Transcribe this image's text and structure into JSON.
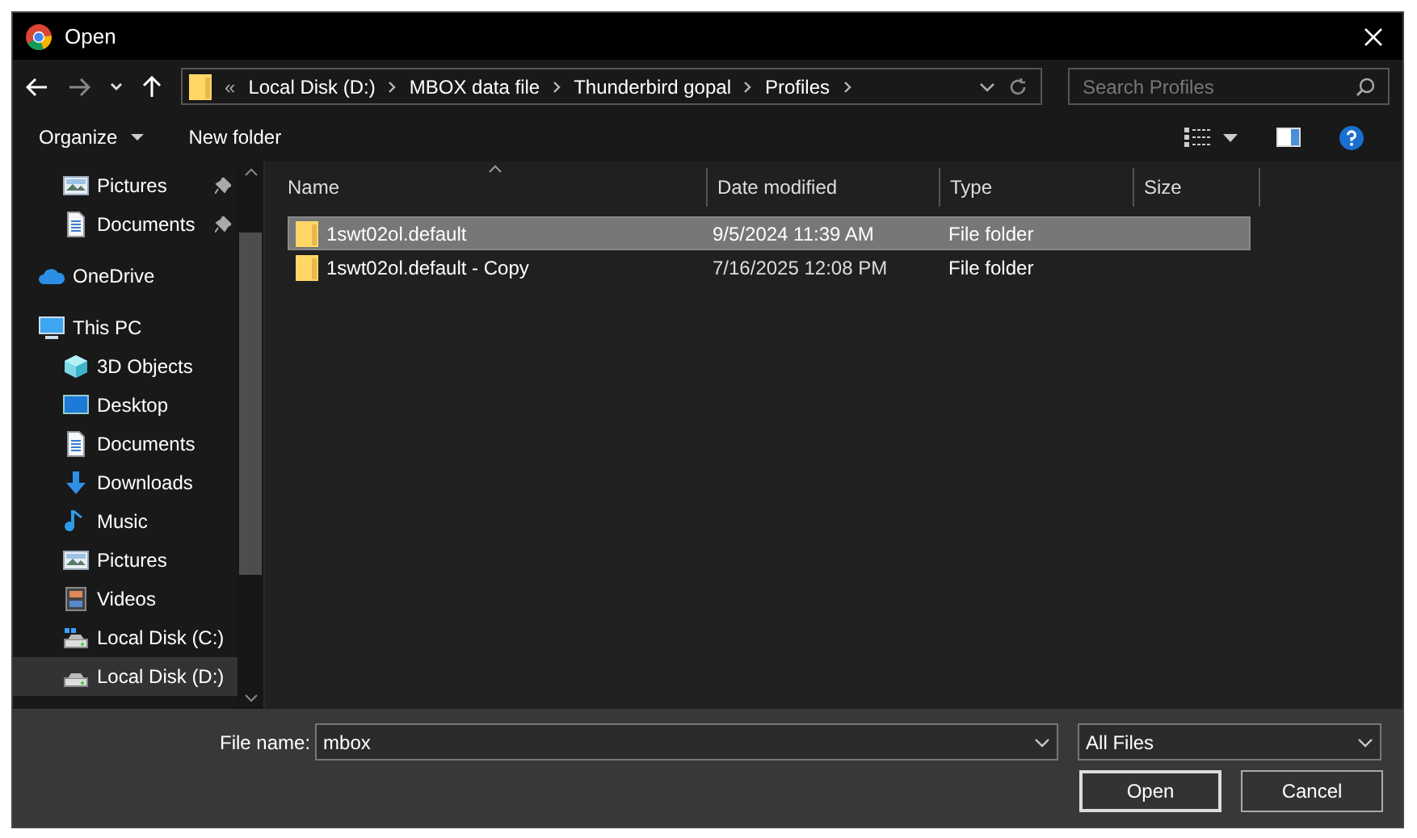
{
  "window": {
    "title": "Open"
  },
  "address": {
    "crumbs": [
      "Local Disk (D:)",
      "MBOX data file",
      "Thunderbird gopal",
      "Profiles"
    ],
    "overflow": "«"
  },
  "search": {
    "placeholder": "Search Profiles"
  },
  "toolbar": {
    "organize": "Organize",
    "new_folder": "New folder"
  },
  "sidebar": {
    "items": [
      {
        "label": "Pictures",
        "kind": "pictures",
        "pinned": true,
        "indent": true,
        "selected": false
      },
      {
        "label": "Documents",
        "kind": "documents",
        "pinned": true,
        "indent": true,
        "selected": false
      },
      {
        "label": "OneDrive",
        "kind": "cloud",
        "pinned": false,
        "indent": false,
        "selected": false
      },
      {
        "label": "This PC",
        "kind": "pc",
        "pinned": false,
        "indent": false,
        "selected": false
      },
      {
        "label": "3D Objects",
        "kind": "cube",
        "pinned": false,
        "indent": true,
        "selected": false
      },
      {
        "label": "Desktop",
        "kind": "desktop",
        "pinned": false,
        "indent": true,
        "selected": false
      },
      {
        "label": "Documents",
        "kind": "documents",
        "pinned": false,
        "indent": true,
        "selected": false
      },
      {
        "label": "Downloads",
        "kind": "download",
        "pinned": false,
        "indent": true,
        "selected": false
      },
      {
        "label": "Music",
        "kind": "music",
        "pinned": false,
        "indent": true,
        "selected": false
      },
      {
        "label": "Pictures",
        "kind": "pictures",
        "pinned": false,
        "indent": true,
        "selected": false
      },
      {
        "label": "Videos",
        "kind": "videos",
        "pinned": false,
        "indent": true,
        "selected": false
      },
      {
        "label": "Local Disk (C:)",
        "kind": "disk_c",
        "pinned": false,
        "indent": true,
        "selected": false
      },
      {
        "label": "Local Disk (D:)",
        "kind": "disk",
        "pinned": false,
        "indent": true,
        "selected": true
      }
    ]
  },
  "table": {
    "columns": [
      "Name",
      "Date modified",
      "Type",
      "Size"
    ],
    "rows": [
      {
        "name": "1swt02ol.default",
        "date": "9/5/2024 11:39 AM",
        "type": "File folder",
        "selected": true
      },
      {
        "name": "1swt02ol.default - Copy",
        "date": "7/16/2025 12:08 PM",
        "type": "File folder",
        "selected": false
      }
    ]
  },
  "footer": {
    "file_name_label": "File name:",
    "file_name": "mbox",
    "filter": "All Files",
    "buttons": [
      "Open",
      "Cancel"
    ]
  }
}
